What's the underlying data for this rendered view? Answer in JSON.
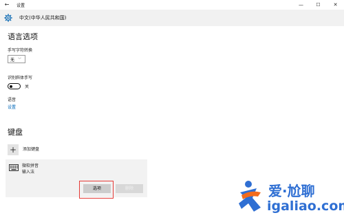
{
  "titlebar": {
    "app_title": "设置",
    "back_icon": "back-arrow-icon",
    "minimize_glyph": "—",
    "maximize_glyph": "☐",
    "close_glyph": "✕"
  },
  "header": {
    "icon": "gear-icon",
    "page_title": "中文(中华人民共和国)"
  },
  "language_options": {
    "title": "语言选项",
    "handwriting_switch_label": "手写字符转换",
    "handwriting_switch_value": "无",
    "cursive_label": "识别斜体手写",
    "cursive_toggle_state": "关",
    "speech_label": "语音",
    "speech_link": "设置"
  },
  "keyboard": {
    "title": "键盘",
    "add_keyboard_label": "添加键盘",
    "item_name_line1": "微软拼音",
    "item_name_line2": "输入法",
    "options_button": "选项",
    "remove_button": "删除",
    "highlight_color": "#e53935"
  },
  "watermark": {
    "cn_text": "爱·尬聊",
    "url_text": "igaliao.com",
    "color": "#2f6fd3",
    "accent_color": "#f26b1d"
  }
}
